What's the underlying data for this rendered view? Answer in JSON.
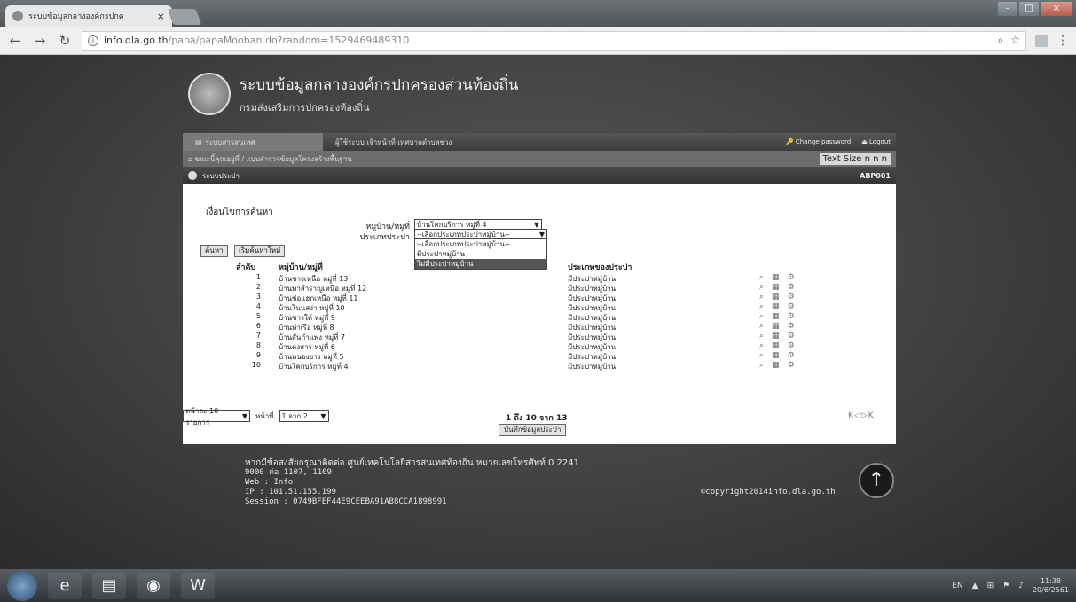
{
  "browser": {
    "tab_title": "ระบบข้อมูลกลางองค์กรปกค",
    "url_host": "info.dla.go.th",
    "url_path": "/papa/papaMooban.do?random=1529469489310"
  },
  "site": {
    "title": "ระบบข้อมูลกลางองค์กรปกครองส่วนท้องถิ่น",
    "subtitle": "กรมส่งเสริมการปกครองท้องถิ่น"
  },
  "mainbar": {
    "tab_active": "ระบบสารสนเทศ",
    "tab_user": "ผู้ใช้ระบบ เจ้าหน้าที่ เทศบาลตำบลช่วง",
    "change_password": "Change password",
    "logout": "Logout"
  },
  "breadcrumb": {
    "text": "ขณะนี้คุณอยู่ที่ / แบบสำรวจข้อมูลโครงสร้างพื้นฐาน",
    "text_size_label": "Text Size",
    "text_size_options": "n n n"
  },
  "section": {
    "title": "ระบบประปา",
    "code": "ABP001"
  },
  "search": {
    "criteria_title": "เงื่อนไขการค้นหา",
    "village_label": "หมู่บ้าน/หมู่ที่",
    "village_value": "บ้านโคกบริการ หมู่ที่ 4",
    "type_label": "ประเภทประปา",
    "type_value": "--เลือกประเภทประปาหมู่บ้าน--",
    "type_options": [
      "--เลือกประเภทประปาหมู่บ้าน--",
      "มีประปาหมู่บ้าน",
      "ไม่มีประปาหมู่บ้าน"
    ],
    "search_button": "ค้นหา",
    "reset_button": "เริ่มค้นหาใหม่"
  },
  "table": {
    "col_no": "ลำดับ",
    "col_village": "หมู่บ้าน/หมู่ที่",
    "col_type": "ประเภทของประปา",
    "rows": [
      {
        "no": "1",
        "village": "บ้านขางเหนือ หมู่ที่ 13",
        "type": "มีประปาหมู่บ้าน"
      },
      {
        "no": "2",
        "village": "บ้านทาสำราญเหนือ หมู่ที่ 12",
        "type": "มีประปาหมู่บ้าน"
      },
      {
        "no": "3",
        "village": "บ้านช่อแฮกเหนือ หมู่ที่ 11",
        "type": "มีประปาหมู่บ้าน"
      },
      {
        "no": "4",
        "village": "บ้านโนนสง่า หมู่ที่ 10",
        "type": "มีประปาหมู่บ้าน"
      },
      {
        "no": "5",
        "village": "บ้านขางใต้ หมู่ที่ 9",
        "type": "มีประปาหมู่บ้าน"
      },
      {
        "no": "6",
        "village": "บ้านท่าเรือ หมู่ที่ 8",
        "type": "มีประปาหมู่บ้าน"
      },
      {
        "no": "7",
        "village": "บ้านสันกำแพง หมู่ที่ 7",
        "type": "มีประปาหมู่บ้าน"
      },
      {
        "no": "8",
        "village": "บ้านดงสาร หมู่ที่ 6",
        "type": "มีประปาหมู่บ้าน"
      },
      {
        "no": "9",
        "village": "บ้านหนองยาง หมู่ที่ 5",
        "type": "มีประปาหมู่บ้าน"
      },
      {
        "no": "10",
        "village": "บ้านโคกบริการ หมู่ที่ 4",
        "type": "มีประปาหมู่บ้าน"
      }
    ]
  },
  "pager": {
    "per_page": "หน้าละ 10 รายการ",
    "page_label": "หน้าที่",
    "page_value": "1 จาก 2",
    "info": "1 ถึง 10 จาก 13",
    "save_button": "บันทึกข้อมูลประปา",
    "nav": "K◁▷K"
  },
  "footer": {
    "contact": "หากมีข้อสงสัยกรุณาติดต่อ ศูนย์เทคโนโลยีสารสนเทศท้องถิ่น หมายเลขโทรศัพท์ 0 2241",
    "phone2": "9000 ต่อ 1107, 1109",
    "web": "Web : Info",
    "ip": "IP : 101.51.155.199",
    "session": "Session : 0749BFEF44E9CEEBA91AB8CCA1898991",
    "copyright": "©copyright2014info.dla.go.th"
  },
  "taskbar": {
    "lang": "EN",
    "time": "11:38",
    "date": "20/6/2561"
  }
}
